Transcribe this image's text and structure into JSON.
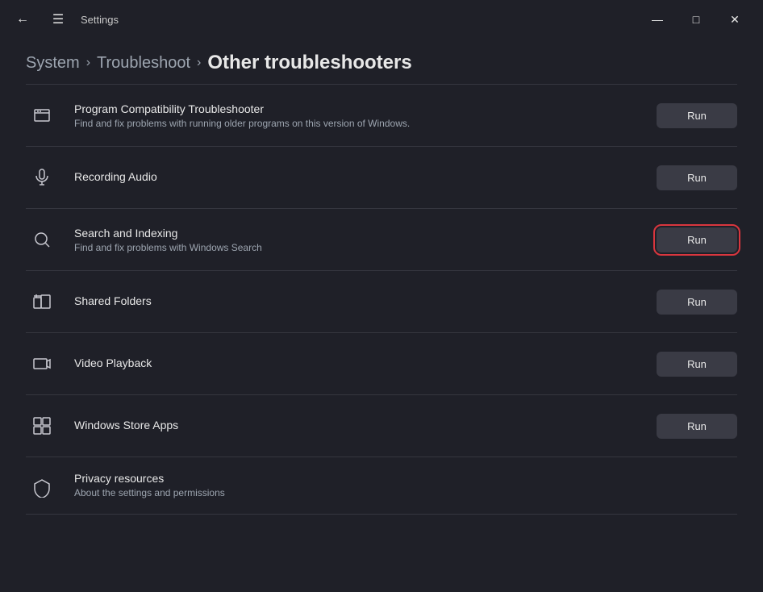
{
  "titleBar": {
    "title": "Settings",
    "backLabel": "←",
    "menuLabel": "☰",
    "minimizeLabel": "—",
    "maximizeLabel": "□",
    "closeLabel": "✕"
  },
  "breadcrumb": {
    "system": "System",
    "troubleshoot": "Troubleshoot",
    "current": "Other troubleshooters",
    "sep": "›"
  },
  "items": [
    {
      "id": "program-compat",
      "icon": "≡☰",
      "title": "Program Compatibility Troubleshooter",
      "desc": "Find and fix problems with running older programs on this version of Windows.",
      "runLabel": "Run",
      "highlighted": false
    },
    {
      "id": "recording-audio",
      "icon": "🎤",
      "title": "Recording Audio",
      "desc": "",
      "runLabel": "Run",
      "highlighted": false
    },
    {
      "id": "search-indexing",
      "icon": "🔍",
      "title": "Search and Indexing",
      "desc": "Find and fix problems with Windows Search",
      "runLabel": "Run",
      "highlighted": true
    },
    {
      "id": "shared-folders",
      "icon": "📁",
      "title": "Shared Folders",
      "desc": "",
      "runLabel": "Run",
      "highlighted": false
    },
    {
      "id": "video-playback",
      "icon": "📹",
      "title": "Video Playback",
      "desc": "",
      "runLabel": "Run",
      "highlighted": false
    },
    {
      "id": "windows-store-apps",
      "icon": "⬜",
      "title": "Windows Store Apps",
      "desc": "",
      "runLabel": "Run",
      "highlighted": false
    },
    {
      "id": "privacy-resources",
      "icon": "🛡",
      "title": "Privacy resources",
      "desc": "About the settings and permissions",
      "runLabel": "",
      "highlighted": false,
      "partial": true
    }
  ]
}
